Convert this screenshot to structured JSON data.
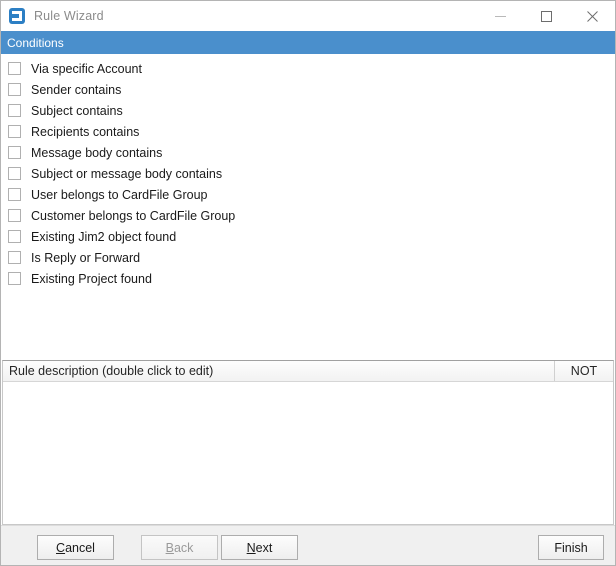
{
  "window": {
    "title": "Rule Wizard",
    "icon": "app-icon",
    "controls": [
      {
        "name": "minimize-button",
        "glyph": "minimize-icon"
      },
      {
        "name": "maximize-button",
        "glyph": "maximize-icon"
      },
      {
        "name": "close-button",
        "glyph": "close-icon"
      }
    ]
  },
  "conditions": {
    "header": "Conditions",
    "header_color": "#4a8fcc",
    "items": [
      {
        "label": "Via specific Account",
        "checked": false
      },
      {
        "label": "Sender contains",
        "checked": false
      },
      {
        "label": "Subject contains",
        "checked": false
      },
      {
        "label": "Recipients contains",
        "checked": false
      },
      {
        "label": "Message body contains",
        "checked": false
      },
      {
        "label": "Subject or message body contains",
        "checked": false
      },
      {
        "label": "User belongs to CardFile Group",
        "checked": false
      },
      {
        "label": "Customer belongs to CardFile Group",
        "checked": false
      },
      {
        "label": "Existing Jim2 object found",
        "checked": false
      },
      {
        "label": "Is Reply or Forward",
        "checked": false
      },
      {
        "label": "Existing Project found",
        "checked": false
      }
    ]
  },
  "description": {
    "column_main": "Rule description (double click to edit)",
    "column_not": "NOT",
    "rows": []
  },
  "footer": {
    "cancel": {
      "pre": "",
      "accel": "C",
      "post": "ancel",
      "disabled": false
    },
    "back": {
      "pre": "",
      "accel": "B",
      "post": "ack",
      "disabled": true
    },
    "next": {
      "pre": "",
      "accel": "N",
      "post": "ext",
      "disabled": false
    },
    "finish": {
      "label": "Finish",
      "disabled": false
    }
  }
}
